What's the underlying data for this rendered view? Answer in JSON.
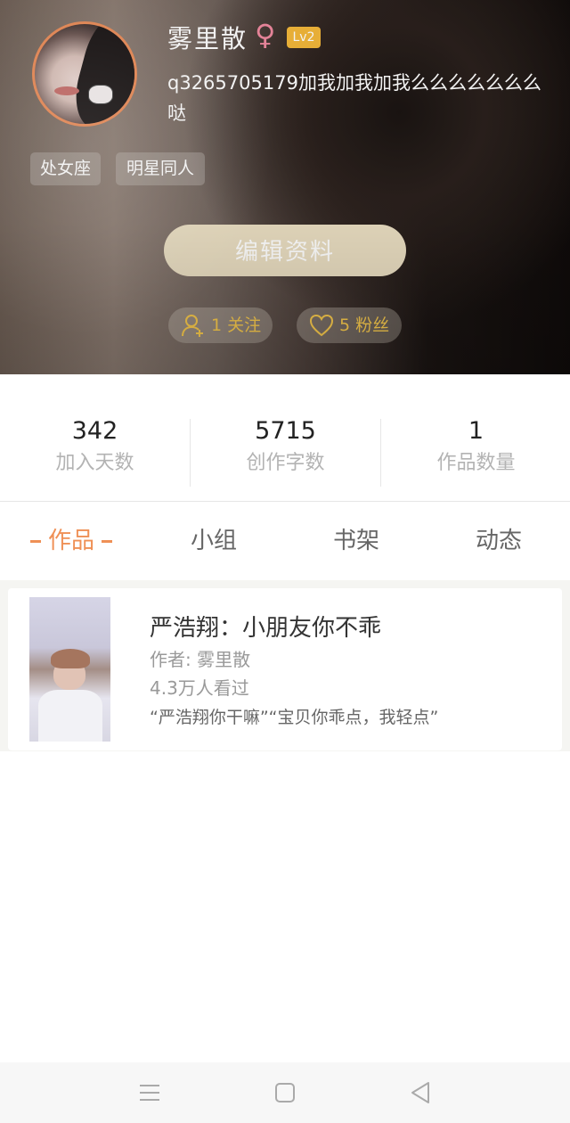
{
  "profile": {
    "name": "雾里散",
    "gender_symbol": "♀",
    "level": "Lv2",
    "bio": "q3265705179加我加我加我么么么么么么么哒",
    "tags": [
      "处女座",
      "明星同人"
    ],
    "edit_label": "编辑资料",
    "following_label": "1 关注",
    "fans_label": "5 粉丝"
  },
  "stats": [
    {
      "value": "342",
      "label": "加入天数"
    },
    {
      "value": "5715",
      "label": "创作字数"
    },
    {
      "value": "1",
      "label": "作品数量"
    }
  ],
  "tabs": [
    "作品",
    "小组",
    "书架",
    "动态"
  ],
  "works": [
    {
      "title": "严浩翔：小朋友你不乖",
      "author": "作者: 雾里散",
      "views": "4.3万人看过",
      "excerpt": "“严浩翔你干嘛”“宝贝你乖点，我轻点”"
    }
  ],
  "colors": {
    "accent": "#ef9056",
    "level_badge": "#f3b73a",
    "pill_text": "#f6c84c",
    "edit_button": "#e8dcc0"
  }
}
